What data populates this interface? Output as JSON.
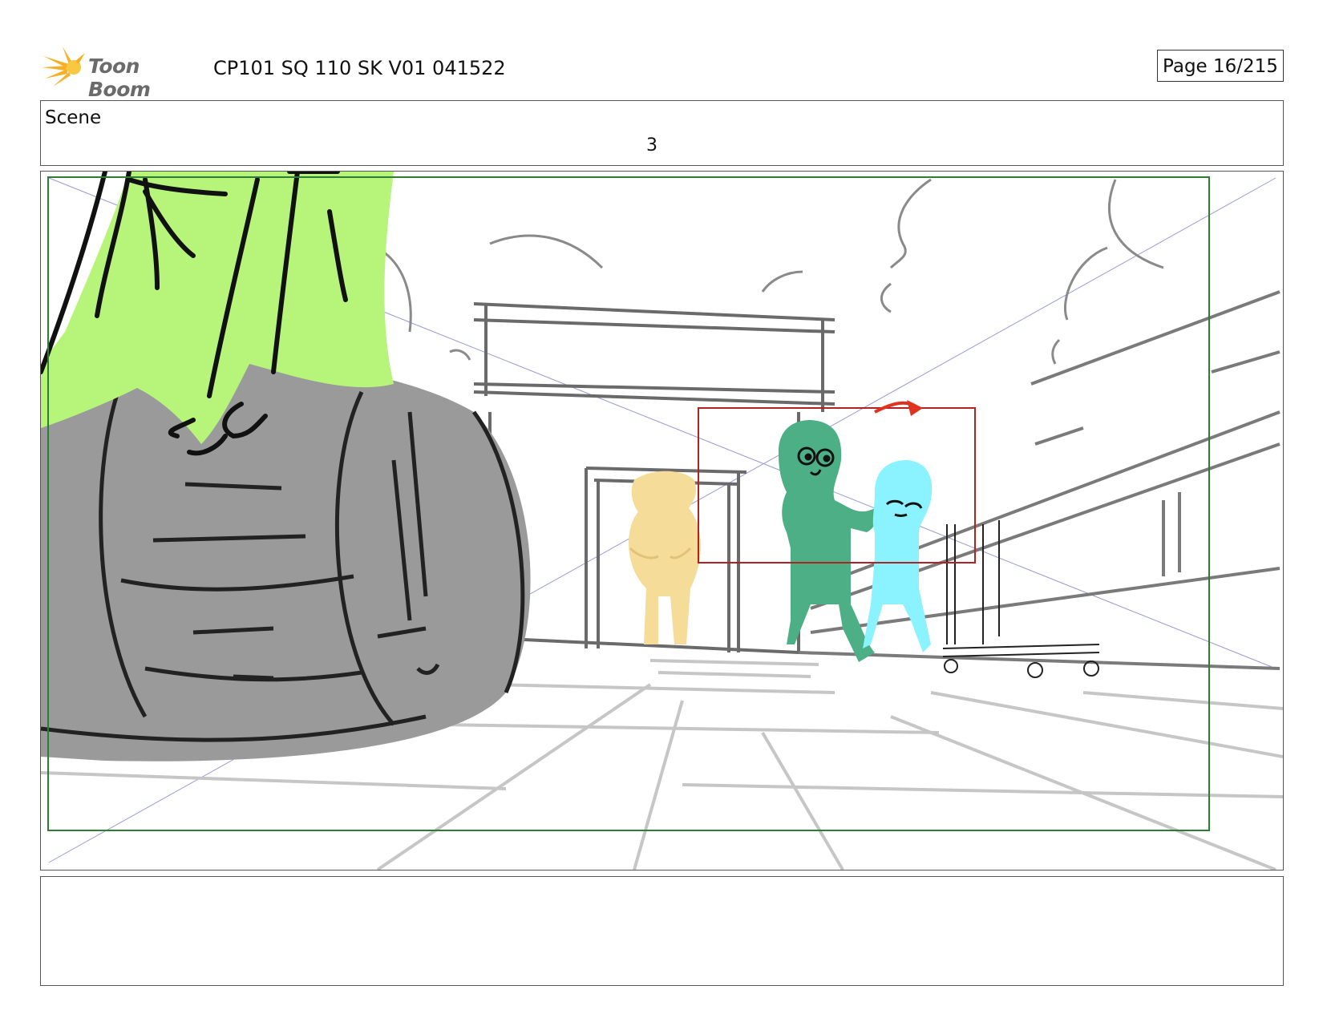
{
  "header": {
    "logo_text": "Toon Boom",
    "title": "CP101 SQ 110 SK V01 041522",
    "page": "Page 16/215"
  },
  "scene": {
    "label": "Scene",
    "number": "3"
  },
  "panel": {
    "image_icon": "storyboard-sketch-image"
  },
  "notes": {
    "text": ""
  },
  "colors": {
    "logo_orange": "#f5a623",
    "green_char": "#b7f57a",
    "teal_char": "#4daf85",
    "cyan_char": "#8af3ff",
    "yellow_char": "#f5dc98",
    "barrel": "#9a9a9a",
    "safe_frame": "#2e7d32",
    "camera_box": "#b22222"
  }
}
